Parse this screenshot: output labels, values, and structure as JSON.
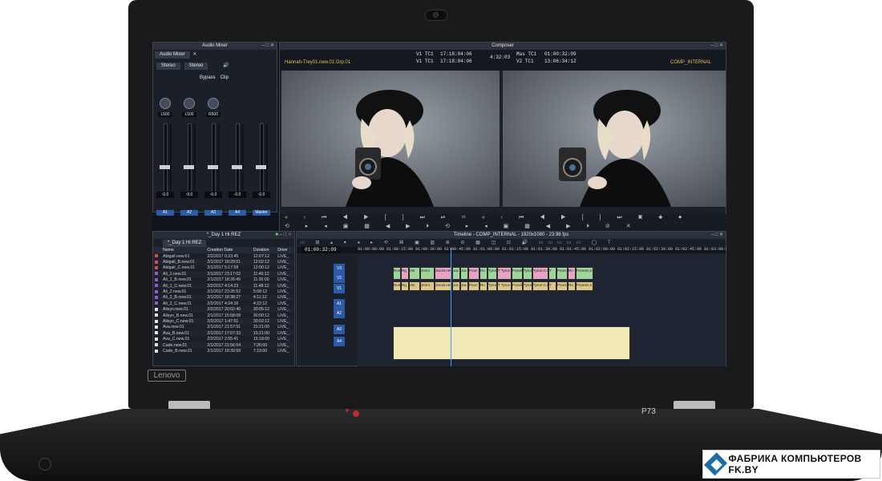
{
  "laptop": {
    "brand_badge": "Lenovo",
    "model": "P73"
  },
  "watermark": {
    "text": "ФАБРИКА КОМПЬЮТЕРОВ FK.BY"
  },
  "audio_mixer": {
    "title": "Audio Mixer",
    "tab": "Audio Mixer",
    "stereo_a": "Stereo",
    "stereo_b": "Stereo",
    "bypass": "Bypass",
    "clip": "Clip",
    "pan_values": [
      "L500",
      "L500",
      "R500"
    ],
    "db_values": [
      "-0.0",
      "-0.0",
      "-0.0",
      "-0.0",
      "-0.0"
    ],
    "channels": [
      "A1",
      "A2",
      "A3",
      "A4",
      "Master"
    ],
    "fader_levels": [
      0.38,
      0.38,
      0.38,
      0.38,
      0.38
    ]
  },
  "composer": {
    "title": "Composer",
    "source_clip": "Hannah-Trey01.new.01.Grp.01",
    "sequence": "COMP_INTERNAL",
    "tc_rows": [
      {
        "label": "V1 TC1",
        "value": "17:18:04:06"
      },
      {
        "label": "V1 TC1",
        "value": "17:18:04:06"
      },
      {
        "label": "Mas TC1",
        "value": "01:00:32:09"
      },
      {
        "label": "V2 TC1",
        "value": "13:06:34:12"
      }
    ],
    "duration": "4:32:03"
  },
  "bin": {
    "title": "*_Day 1 Hi REZ",
    "tab": "*_Day 1 Hi REZ",
    "columns": [
      "Name",
      "Creation Date",
      "Duration",
      "Drive"
    ],
    "rows": [
      {
        "name": "Abigail.new.01",
        "date": "2/2/2017 0:23:45",
        "duration": "12:07:12",
        "drive": "LIVE_",
        "color": "#d94c4c"
      },
      {
        "name": "Abigail_B.new.01",
        "date": "2/1/2017 18:29:51",
        "duration": "12:02:12",
        "drive": "LIVE_",
        "color": "#d94c4c"
      },
      {
        "name": "Abigail_C.new.01",
        "date": "2/1/2017 5:17:58",
        "duration": "12:00:12",
        "drive": "LIVE_",
        "color": "#d94c4c"
      },
      {
        "name": "Ali_1.new.01",
        "date": "2/1/2017 23:17:02",
        "duration": "11:46:12",
        "drive": "LIVE_",
        "color": "#8b5cd6"
      },
      {
        "name": "Ali_1_B.new.01",
        "date": "2/1/2017 18:26:45",
        "duration": "11:36:00",
        "drive": "LIVE_",
        "color": "#8b5cd6"
      },
      {
        "name": "Ali_1_C.new.01",
        "date": "2/2/2017 4:14:23",
        "duration": "11:48:12",
        "drive": "LIVE_",
        "color": "#8b5cd6"
      },
      {
        "name": "Ali_2.new.01",
        "date": "2/1/2017 23:26:52",
        "duration": "5:58:12",
        "drive": "LIVE_",
        "color": "#8b5cd6"
      },
      {
        "name": "Ali_2_B.new.01",
        "date": "2/1/2017 18:38:27",
        "duration": "4:11:12",
        "drive": "LIVE_",
        "color": "#8b5cd6"
      },
      {
        "name": "Ali_2_C.new.01",
        "date": "2/2/2017 4:24:16",
        "duration": "4:22:12",
        "drive": "LIVE_",
        "color": "#8b5cd6"
      },
      {
        "name": "Alisyn.new.01",
        "date": "2/2/2017 20:02:40",
        "duration": "30:05:12",
        "drive": "LIVE_",
        "color": "#e2e2e2"
      },
      {
        "name": "Alisyn_B.new.01",
        "date": "2/1/2017 15:58:08",
        "duration": "30:00:12",
        "drive": "LIVE_",
        "color": "#e2e2e2"
      },
      {
        "name": "Alisyn_C.new.01",
        "date": "2/2/2017 1:47:51",
        "duration": "30:02:12",
        "drive": "LIVE_",
        "color": "#e2e2e2"
      },
      {
        "name": "Ava.new.01",
        "date": "2/1/2017 21:57:51",
        "duration": "15:21:00",
        "drive": "LIVE_",
        "color": "#e2e2e2"
      },
      {
        "name": "Ava_B.new.01",
        "date": "2/1/2017 17:07:33",
        "duration": "15:21:00",
        "drive": "LIVE_",
        "color": "#e2e2e2"
      },
      {
        "name": "Ava_C.new.01",
        "date": "2/2/2017 2:55:41",
        "duration": "15:18:00",
        "drive": "LIVE_",
        "color": "#e2e2e2"
      },
      {
        "name": "Cade.new.01",
        "date": "2/1/2017 21:56:54",
        "duration": "7:26:00",
        "drive": "LIVE_",
        "color": "#e2e2e2"
      },
      {
        "name": "Cade_B.new.01",
        "date": "2/1/2017 18:39:59",
        "duration": "7:19:00",
        "drive": "LIVE_",
        "color": "#e2e2e2"
      }
    ]
  },
  "timeline": {
    "title": "Timeline - COMP_INTERNAL - 1920x1080 - 23.98 fps",
    "timecode": "01:00:32:09",
    "ruler": [
      "01:00:00:00",
      "01:00:15:00",
      "01:00:30:00",
      "01:00:45:00",
      "01:01:00:00",
      "01:01:15:00",
      "01:01:30:00",
      "01:01:45:00",
      "01:02:00:00",
      "01:02:15:00",
      "01:02:30:00",
      "01:02:45:00",
      "01:03:00:00"
    ],
    "tracks": [
      "V3",
      "V2",
      "V1",
      "A1",
      "A2",
      "A3",
      "A4"
    ],
    "v1_clip_labels": [
      "Ron",
      "Rg",
      "Ale",
      "Jenni",
      "Jacob.nev",
      "Jac",
      "Jac",
      "Poon",
      "Ro",
      "Tyrus",
      "T Tyrus",
      "Ponoln",
      "Tyrus",
      "Tyrus-C.new",
      "T",
      "Pooni",
      "Ro",
      "Poonen.n"
    ],
    "a_clip_labels": [
      "Ron",
      "Rg",
      "Ale",
      "Jenni",
      "Jacob.nev",
      "Jac",
      "Jac",
      "Poon",
      "Ro",
      "Tyrus",
      "T Tyrus",
      "Ponoln",
      "Tyrus",
      "Tyrus-C.new",
      "T",
      "Pooni",
      "Ro",
      "Poonen.n"
    ]
  }
}
